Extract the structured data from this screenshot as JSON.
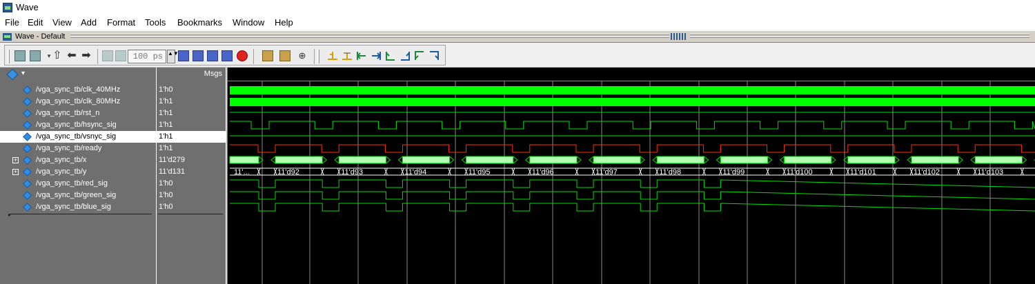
{
  "app": {
    "title": "Wave"
  },
  "menu": [
    "File",
    "Edit",
    "View",
    "Add",
    "Format",
    "Tools",
    "Bookmarks",
    "Window",
    "Help"
  ],
  "window": {
    "title": "Wave - Default"
  },
  "toolbar": {
    "zoom_value": "100 ps",
    "zoom_spin": "▲▼"
  },
  "columns": {
    "msgs_label": "Msgs"
  },
  "colors": {
    "clock": "#00ff00",
    "signal": "#00e000",
    "reset": "#ff3000",
    "bus_fill": "#b0ffb0",
    "bus_text": "#ffffff",
    "grid": "#a0a0a0"
  },
  "signals": [
    {
      "name": "/vga_sync_tb/clk_40MHz",
      "value": "1'h0",
      "expandable": false,
      "selected": false
    },
    {
      "name": "/vga_sync_tb/clk_80MHz",
      "value": "1'h1",
      "expandable": false,
      "selected": false
    },
    {
      "name": "/vga_sync_tb/rst_n",
      "value": "1'h1",
      "expandable": false,
      "selected": false
    },
    {
      "name": "/vga_sync_tb/hsync_sig",
      "value": "1'h1",
      "expandable": false,
      "selected": false
    },
    {
      "name": "/vga_sync_tb/vsnyc_sig",
      "value": "1'h1",
      "expandable": false,
      "selected": true
    },
    {
      "name": "/vga_sync_tb/ready",
      "value": "1'h1",
      "expandable": false,
      "selected": false
    },
    {
      "name": "/vga_sync_tb/x",
      "value": "11'd279",
      "expandable": true,
      "selected": false
    },
    {
      "name": "/vga_sync_tb/y",
      "value": "11'd131",
      "expandable": true,
      "selected": false
    },
    {
      "name": "/vga_sync_tb/red_sig",
      "value": "1'h0",
      "expandable": false,
      "selected": false
    },
    {
      "name": "/vga_sync_tb/green_sig",
      "value": "1'h0",
      "expandable": false,
      "selected": false
    },
    {
      "name": "/vga_sync_tb/blue_sig",
      "value": "1'h0",
      "expandable": false,
      "selected": false
    }
  ],
  "y_bus_labels": [
    "11'...",
    "11'd92",
    "11'd93",
    "11'd94",
    "11'd95",
    "11'd96",
    "11'd97",
    "11'd98",
    "11'd99",
    "11'd100",
    "11'd101",
    "11'd102",
    "11'd103"
  ]
}
